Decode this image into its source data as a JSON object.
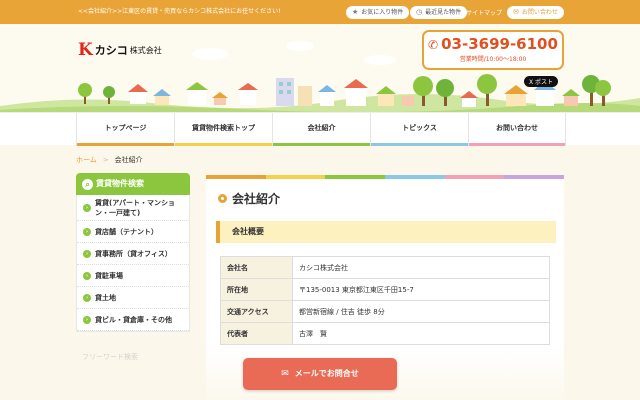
{
  "topbar": {
    "tagline": "<<会社紹介>>江東区の賃貸・売買ならカシコ株式会社にお任せください!",
    "favorites_label": "お気に入り物件",
    "recent_label": "最近見た物件",
    "sitemap_label": "サイトマップ",
    "contact_label": "お問い合わせ",
    "bg_color": "#e9a437"
  },
  "header": {
    "logo_mark": "K",
    "logo_name": "カシコ",
    "logo_suffix": "株式会社",
    "phone": "03-3699-6100",
    "hours": "営業時間/10:00～18:00",
    "post_label": "X ポスト"
  },
  "nav": {
    "items": [
      {
        "label": "トップページ",
        "color": "#e8a337"
      },
      {
        "label": "賃貸物件検索トップ",
        "color": "#f2d24a"
      },
      {
        "label": "会社紹介",
        "color": "#8cc63e"
      },
      {
        "label": "トピックス",
        "color": "#8bc8e6"
      },
      {
        "label": "お問い合わせ",
        "color": "#f2a1b8"
      }
    ]
  },
  "breadcrumb": {
    "home": "ホーム",
    "separator": ">",
    "current": "会社紹介"
  },
  "sidebar": {
    "title": "賃貸物件検索",
    "items": [
      "賃貸(アパート・マンション・一戸建て)",
      "貸店舗（テナント）",
      "貸事務所（貸オフィス）",
      "貸駐車場",
      "貸土地",
      "貸ビル・貸倉庫・その他"
    ],
    "faint_label": "フリーワード検索",
    "accent": "#8cc63e"
  },
  "main": {
    "page_title": "会社紹介",
    "section_title": "会社概要",
    "rows": [
      {
        "key": "会社名",
        "value": "カシコ株式会社"
      },
      {
        "key": "所在地",
        "value": "〒135-0013 東京都江東区千田15-7"
      },
      {
        "key": "交通アクセス",
        "value": "都営新宿線 / 住吉 徒歩 8分"
      },
      {
        "key": "代表者",
        "value": "古澤　賢"
      }
    ],
    "rainbow": [
      "#e8a337",
      "#f2d24a",
      "#8cc63e",
      "#8bc8e6",
      "#f2a1b8",
      "#c7a6e0"
    ]
  },
  "mail_button": {
    "label": "メールでお問合せ",
    "color": "#e96a55"
  }
}
